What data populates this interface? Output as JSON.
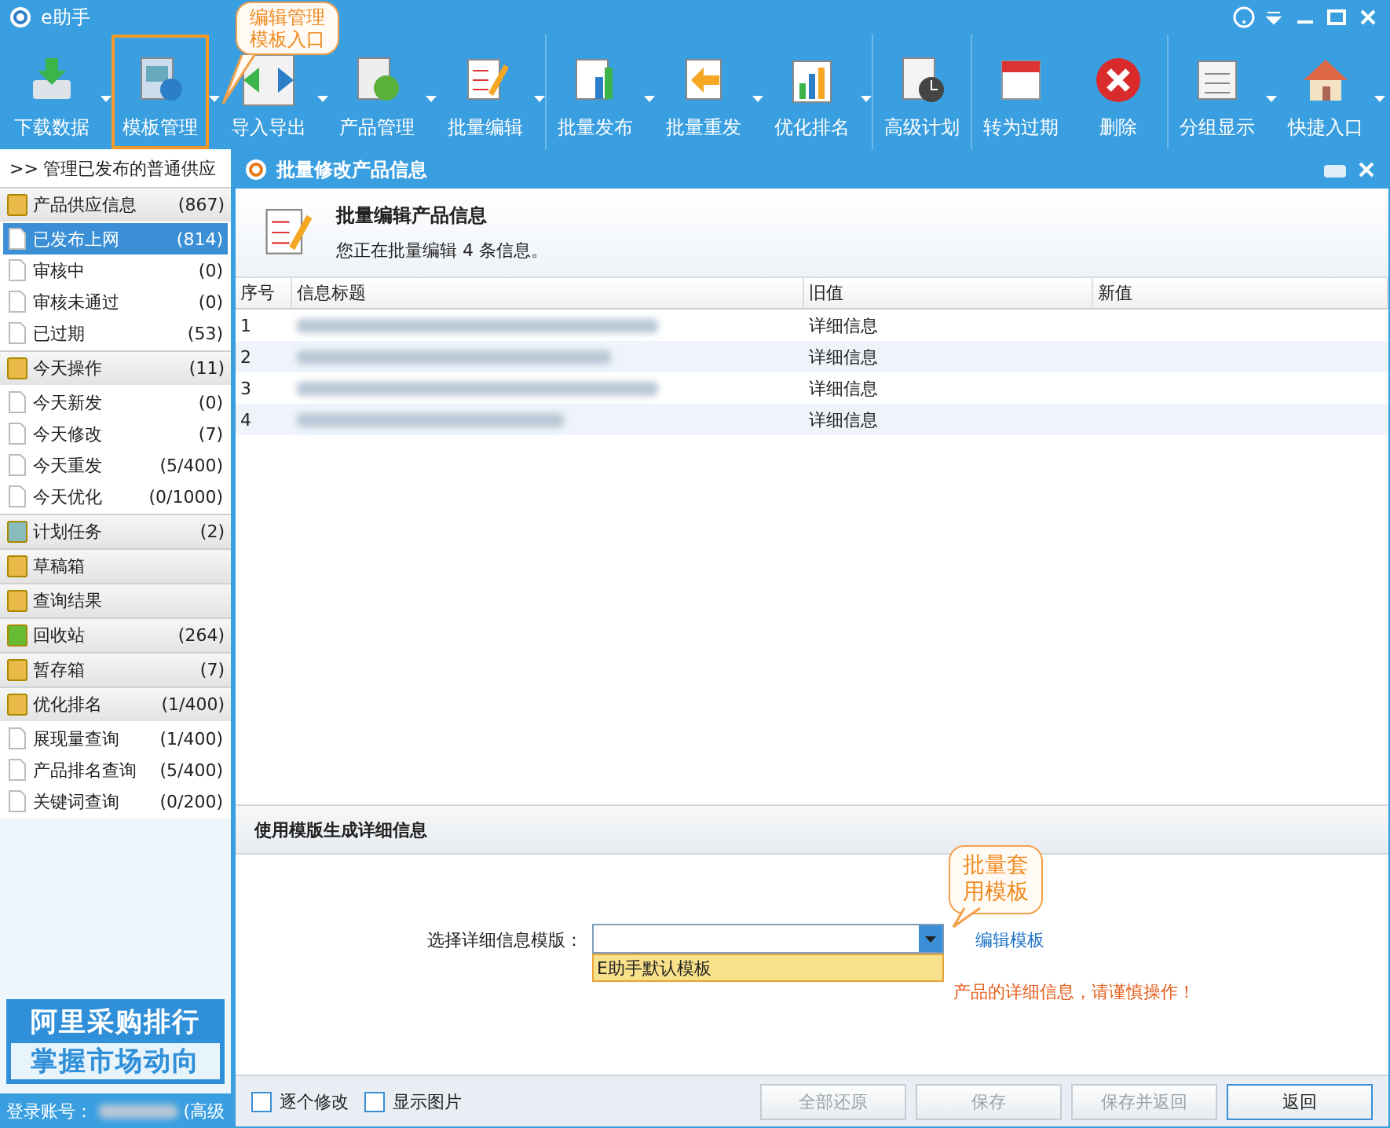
{
  "window": {
    "title": "e助手"
  },
  "toolbar": {
    "groups": [
      [
        {
          "label": "下载数据",
          "has_menu": true,
          "highlighted": false
        },
        {
          "label": "模板管理",
          "has_menu": true,
          "highlighted": true
        },
        {
          "label": "导入导出",
          "has_menu": true,
          "highlighted": false
        },
        {
          "label": "产品管理",
          "has_menu": true,
          "highlighted": false
        },
        {
          "label": "批量编辑",
          "has_menu": true,
          "highlighted": false
        }
      ],
      [
        {
          "label": "批量发布",
          "has_menu": true,
          "highlighted": false
        },
        {
          "label": "批量重发",
          "has_menu": true,
          "highlighted": false
        },
        {
          "label": "优化排名",
          "has_menu": true,
          "highlighted": false
        }
      ],
      [
        {
          "label": "高级计划",
          "has_menu": false,
          "highlighted": false
        }
      ],
      [
        {
          "label": "转为过期",
          "has_menu": false,
          "highlighted": false
        },
        {
          "label": "删除",
          "has_menu": false,
          "highlighted": false
        }
      ],
      [
        {
          "label": "分组显示",
          "has_menu": true,
          "highlighted": false
        },
        {
          "label": "快捷入口",
          "has_menu": true,
          "highlighted": false
        }
      ]
    ]
  },
  "callouts": [
    {
      "lines": [
        "编辑管理",
        "模板入口"
      ]
    },
    {
      "lines": [
        "批量套",
        "用模板"
      ]
    }
  ],
  "sidebar": {
    "expander": ">>",
    "header": "管理已发布的普通供应",
    "groups": [
      {
        "label": "产品供应信息",
        "count": "(867)",
        "children": [
          {
            "label": "已发布上网",
            "count": "(814)",
            "selected": true
          },
          {
            "label": "审核中",
            "count": "(0)",
            "selected": false
          },
          {
            "label": "审核未通过",
            "count": "(0)",
            "selected": false
          },
          {
            "label": "已过期",
            "count": "(53)",
            "selected": false
          }
        ]
      },
      {
        "label": "今天操作",
        "count": "(11)",
        "children": [
          {
            "label": "今天新发",
            "count": "(0)",
            "selected": false
          },
          {
            "label": "今天修改",
            "count": "(7)",
            "selected": false
          },
          {
            "label": "今天重发",
            "count": "(5/400)",
            "selected": false
          },
          {
            "label": "今天优化",
            "count": "(0/1000)",
            "selected": false
          }
        ]
      },
      {
        "label": "计划任务",
        "count": "(2)"
      },
      {
        "label": "草稿箱"
      },
      {
        "label": "查询结果"
      },
      {
        "label": "回收站",
        "count": "(264)"
      },
      {
        "label": "暂存箱",
        "count": "(7)"
      },
      {
        "label": "优化排名",
        "count": "(1/400)",
        "children": [
          {
            "label": "展现量查询",
            "count": "(1/400)",
            "selected": false
          },
          {
            "label": "产品排名查询",
            "count": "(5/400)",
            "selected": false
          },
          {
            "label": "关键词查询",
            "count": "(0/200)",
            "selected": false
          }
        ]
      }
    ],
    "banner": [
      "阿里采购排行",
      "掌握市场动向"
    ],
    "status": {
      "label": "登录账号：",
      "suffix": "(高级"
    }
  },
  "dialog": {
    "title": "批量修改产品信息",
    "heading": "批量编辑产品信息",
    "subheading": "您正在批量编辑 4 条信息。",
    "table": {
      "columns": [
        "序号",
        "信息标题",
        "旧值",
        "新值"
      ],
      "rows": [
        {
          "index": "1",
          "old_value": "详细信息"
        },
        {
          "index": "2",
          "old_value": "详细信息"
        },
        {
          "index": "3",
          "old_value": "详细信息"
        },
        {
          "index": "4",
          "old_value": "详细信息"
        }
      ]
    },
    "section_title": "使用模版生成详细信息",
    "template_label": "选择详细信息模版：",
    "dropdown": {
      "expanded": true,
      "options": [
        {
          "label": "E助手默认模板",
          "selected": true
        }
      ]
    },
    "edit_link": "编辑模板",
    "warning": "产品的详细信息，请谨慎操作！",
    "checkboxes": [
      {
        "label": "逐个修改",
        "checked": false
      },
      {
        "label": "显示图片",
        "checked": false
      }
    ],
    "buttons": [
      {
        "label": "全部还原",
        "disabled": true
      },
      {
        "label": "保存",
        "disabled": true
      },
      {
        "label": "保存并返回",
        "disabled": true
      },
      {
        "label": "返回",
        "disabled": false
      }
    ]
  }
}
